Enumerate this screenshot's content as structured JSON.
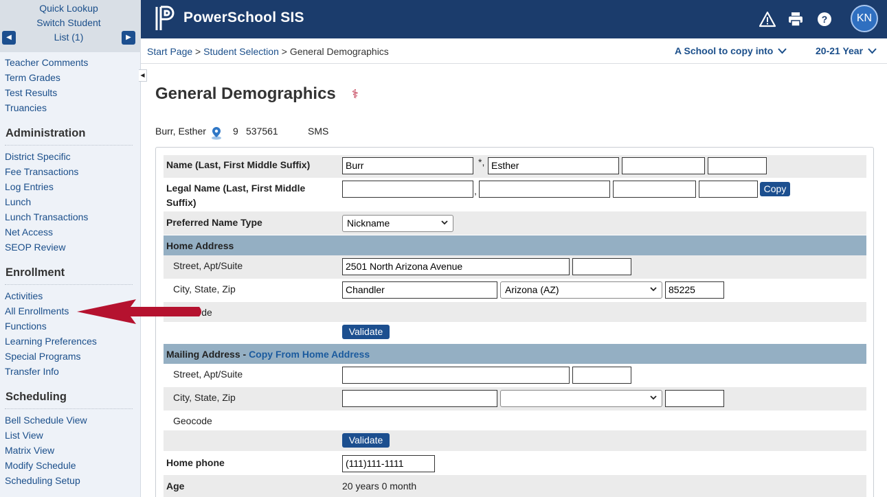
{
  "sidebar": {
    "lookup": [
      "Quick Lookup",
      "Switch Student",
      "List (1)"
    ],
    "top_links": [
      "Teacher Comments",
      "Term Grades",
      "Test Results",
      "Truancies"
    ],
    "sections": [
      {
        "title": "Administration",
        "items": [
          "District Specific",
          "Fee Transactions",
          "Log Entries",
          "Lunch",
          "Lunch Transactions",
          "Net Access",
          "SEOP Review"
        ]
      },
      {
        "title": "Enrollment",
        "items": [
          "Activities",
          "All Enrollments",
          "Functions",
          "Learning Preferences",
          "Special Programs",
          "Transfer Info"
        ]
      },
      {
        "title": "Scheduling",
        "items": [
          "Bell Schedule View",
          "List View",
          "Matrix View",
          "Modify Schedule",
          "Scheduling Setup"
        ]
      }
    ]
  },
  "header": {
    "brand": "PowerSchool SIS",
    "avatar": "KN",
    "icons": [
      "alert-icon",
      "print-icon",
      "help-icon"
    ],
    "color": "#1b3c6c"
  },
  "breadcrumb": {
    "start": "Start Page",
    "student_selection": "Student Selection",
    "current": "General Demographics",
    "school_select": "A School to copy into",
    "year_select": "20-21 Year"
  },
  "page": {
    "title": "General Demographics",
    "student_name": "Burr, Esther",
    "grade": "9",
    "student_number": "537561",
    "school": "SMS"
  },
  "form": {
    "name_label": "Name (Last, First Middle Suffix)",
    "last_name": "Burr",
    "first_name": "Esther",
    "middle_name": "",
    "suffix": "",
    "legal_name_label_1": "Legal Name (Last, First Middle",
    "legal_name_label_2": "Suffix)",
    "copy_button": "Copy",
    "preferred_name_label": "Preferred Name Type",
    "preferred_name_value": "Nickname",
    "home_address_header": "Home Address",
    "street_label": "Street, Apt/Suite",
    "home_street": "2501 North Arizona Avenue",
    "home_apt": "",
    "city_label": "City, State, Zip",
    "home_city": "Chandler",
    "home_state": "Arizona (AZ)",
    "home_zip": "85225",
    "geocode_label": "Geocode",
    "geocode_label_partial": "de",
    "validate_button": "Validate",
    "mailing_header": "Mailing Address - ",
    "mailing_copy_link": "Copy From Home Address",
    "home_phone_label": "Home phone",
    "home_phone": "(111)111-1111",
    "age_label": "Age",
    "age_value": "20 years 0 month"
  },
  "annotation": {
    "arrow_color": "#b5122f"
  }
}
